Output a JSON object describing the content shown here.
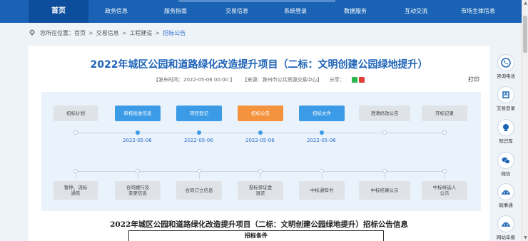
{
  "nav": {
    "items": [
      "首页",
      "政务信息",
      "服务指南",
      "交易信息",
      "系统登录",
      "数据服务",
      "互动交流",
      "市场主体信息"
    ]
  },
  "breadcrumb": {
    "prefix": "您所在位置：",
    "items": [
      "首页",
      "交易信息",
      "工程建设",
      "招标公告"
    ],
    "separator": ">"
  },
  "article": {
    "title": "2022年城区公园和道路绿化改造提升项目（二标：文明创建公园绿地提升）",
    "publish_time": "【发布时间：2022-05-06 00:00 】",
    "source": "【来源：滁州市公共资源交易中心】",
    "share_label": "分享：",
    "print_label": "打印"
  },
  "flow": {
    "top_steps": [
      {
        "label": "招标计划",
        "state": "gray"
      },
      {
        "label": "审核批准信息",
        "state": "blue"
      },
      {
        "label": "项目登记",
        "state": "blue"
      },
      {
        "label": "招标公告",
        "state": "orange"
      },
      {
        "label": "招标文件",
        "state": "blue"
      },
      {
        "label": "澄清修改公告",
        "state": "gray"
      },
      {
        "label": "开标记录",
        "state": "gray"
      }
    ],
    "dates": [
      "2022-05-06",
      "2022-05-06",
      "2022-05-06",
      "2022-05-06"
    ],
    "bottom_steps": [
      {
        "label": "暂停、流标\n通告",
        "state": "gray"
      },
      {
        "label": "合同履行及\n变更信息",
        "state": "gray"
      },
      {
        "label": "合同订立信息",
        "state": "gray"
      },
      {
        "label": "投标保证金\n退还",
        "state": "gray"
      },
      {
        "label": "中标通知书",
        "state": "gray"
      },
      {
        "label": "中标结果公示",
        "state": "gray"
      },
      {
        "label": "中标候选人\n公示",
        "state": "gray"
      }
    ]
  },
  "info": {
    "title": "2022年城区公园和道路绿化改造提升项目（二标：文明创建公园绿地提升）招标公告信息",
    "table_header": "招标条件"
  },
  "side_widgets": [
    {
      "label": "咨询电话",
      "icon": "phone-icon"
    },
    {
      "label": "交易登录",
      "icon": "login-icon"
    },
    {
      "label": "知识库",
      "icon": "knowledge-icon"
    },
    {
      "label": "微信",
      "icon": "wechat-icon"
    },
    {
      "label": "皖事通",
      "icon": "wanshitong-icon"
    },
    {
      "label": "网站年报",
      "icon": "report-icon"
    }
  ],
  "colors": {
    "nav_bg": "#1a63b4",
    "title_blue": "#1e64b8",
    "step_blue": "#3c9be6",
    "step_orange": "#f5923e",
    "step_gray": "#dfe3e8"
  }
}
